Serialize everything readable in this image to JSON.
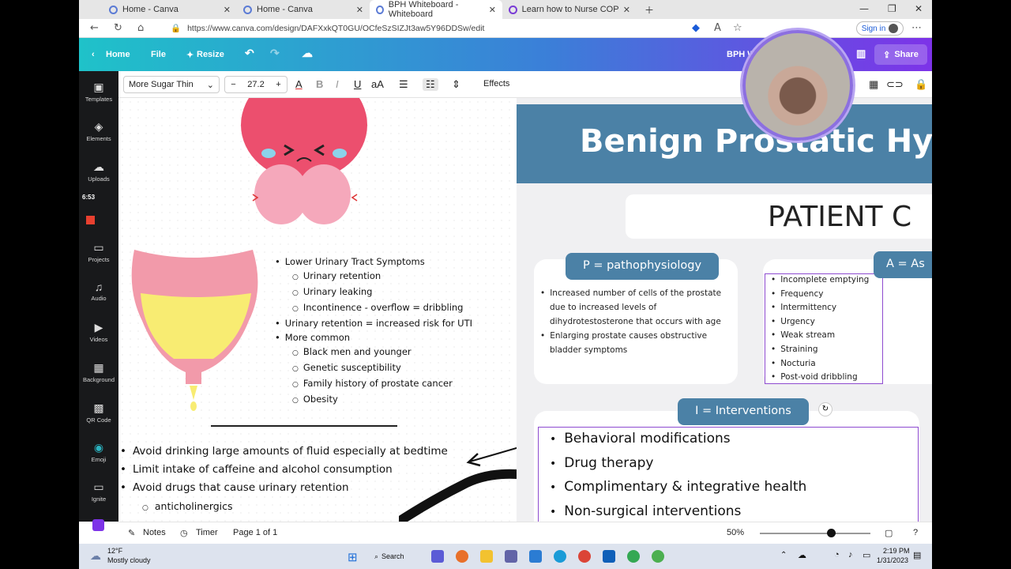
{
  "browser": {
    "tabs": [
      {
        "title": "Home - Canva"
      },
      {
        "title": "Home - Canva"
      },
      {
        "title": "BPH Whiteboard - Whiteboard"
      },
      {
        "title": "Learn how to Nurse COPD White"
      }
    ],
    "url": "https://www.canva.com/design/DAFXxkQT0GU/OCfeSzSIZJt3aw5Y96DDSw/edit",
    "sign_in": "Sign in"
  },
  "canva": {
    "home": "Home",
    "file": "File",
    "resize": "Resize",
    "doc_title": "BPH W",
    "share": "Share",
    "font": "More Sugar Thin",
    "font_size": "27.2",
    "effects": "Effects",
    "sidebar": [
      {
        "label": "Templates"
      },
      {
        "label": "Elements"
      },
      {
        "label": "Uploads"
      },
      {
        "label": "Projects"
      },
      {
        "label": "Audio"
      },
      {
        "label": "Videos"
      },
      {
        "label": "Background"
      },
      {
        "label": "QR Code"
      },
      {
        "label": "Emoji"
      },
      {
        "label": "Ignite"
      }
    ],
    "recording_time": "6:53"
  },
  "left_notes": {
    "bullets": [
      {
        "text": "Lower Urinary Tract Symptoms",
        "level": 1
      },
      {
        "text": "Urinary retention",
        "level": 2
      },
      {
        "text": "Urinary leaking",
        "level": 2
      },
      {
        "text": "Incontinence - overflow = dribbling",
        "level": 2
      },
      {
        "text": "Urinary retention = increased risk for UTI",
        "level": 1
      },
      {
        "text": "More common",
        "level": 1
      },
      {
        "text": "Black men and younger",
        "level": 2
      },
      {
        "text": "Genetic susceptibility",
        "level": 2
      },
      {
        "text": "Family history of prostate cancer",
        "level": 2
      },
      {
        "text": "Obesity",
        "level": 2
      }
    ],
    "lower": [
      {
        "text": "Avoid drinking large amounts of fluid especially at bedtime",
        "level": 1
      },
      {
        "text": "Limit intake of caffeine and alcohol consumption",
        "level": 1
      },
      {
        "text": "Avoid drugs that cause urinary retention",
        "level": 1
      },
      {
        "text": "anticholinergics",
        "level": 2
      }
    ]
  },
  "slide": {
    "title": "Benign Prostatic Hyperpl",
    "subtitle": "PATIENT C",
    "p_label": "P = pathophysiology",
    "p_items": [
      "Increased number of cells of the prostate due to increased levels of dihydrotestosterone that occurs with age",
      "Enlarging prostate causes obstructive bladder symptoms"
    ],
    "a_label": "A = As",
    "a_items": [
      "Incomplete emptying",
      "Frequency",
      "Intermittency",
      "Urgency",
      "Weak stream",
      "Straining",
      "Nocturia",
      "Post-void dribbling"
    ],
    "i_label": "I = Interventions",
    "i_items": [
      "Behavioral modifications",
      "Drug therapy",
      "Complimentary & integrative health",
      "Non-surgical interventions"
    ]
  },
  "bottom": {
    "notes": "Notes",
    "timer": "Timer",
    "page": "Page 1 of 1",
    "zoom": "50%"
  },
  "taskbar": {
    "temp": "12°F",
    "weather": "Mostly cloudy",
    "search": "Search",
    "time": "2:19 PM",
    "date": "1/31/2023"
  },
  "colors": {
    "slide_blue": "#4b81a6",
    "accent_purple": "#8e4bd0"
  }
}
